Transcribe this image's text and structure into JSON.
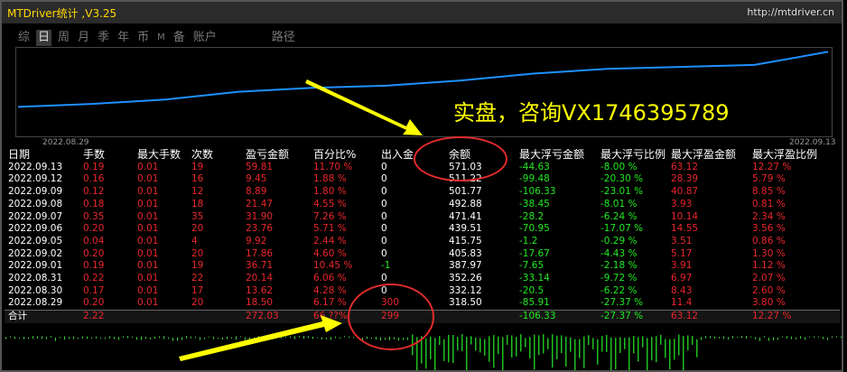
{
  "window": {
    "title": "MTDriver统计 ,V3.25",
    "url": "http://mtdriver.cn"
  },
  "tabs": [
    {
      "label": "综",
      "active": false
    },
    {
      "label": "日",
      "active": true
    },
    {
      "label": "周",
      "active": false
    },
    {
      "label": "月",
      "active": false
    },
    {
      "label": "季",
      "active": false
    },
    {
      "label": "年",
      "active": false
    },
    {
      "label": "币",
      "active": false
    },
    {
      "label": "M",
      "active": false
    },
    {
      "label": "备",
      "active": false
    },
    {
      "label": "账户",
      "active": false
    },
    {
      "label": "路径",
      "active": false
    }
  ],
  "chart_data": {
    "type": "line",
    "x_start": "2022.08.29",
    "x_end": "2022.09.13",
    "x": [
      "2022.08.29",
      "2022.08.30",
      "2022.08.31",
      "2022.09.01",
      "2022.09.02",
      "2022.09.05",
      "2022.09.06",
      "2022.09.07",
      "2022.09.08",
      "2022.09.09",
      "2022.09.12",
      "2022.09.13"
    ],
    "values": [
      318.5,
      332.12,
      352.26,
      387.97,
      405.83,
      415.75,
      439.51,
      471.41,
      492.88,
      501.77,
      511.22,
      571.03
    ],
    "color": "#1e90ff"
  },
  "annotation": {
    "text": "实盘，咨询VX1746395789",
    "color": "#ffff00"
  },
  "table": {
    "headers": [
      "日期",
      "手数",
      "最大手数",
      "次数",
      "盈亏金额",
      "百分比%",
      "出入金",
      "余额",
      "最大浮亏金额",
      "最大浮亏比例",
      "最大浮盈金额",
      "最大浮盈比例"
    ],
    "rows": [
      [
        "2022.09.13",
        "0.19",
        "0.01",
        "19",
        "59.81",
        "11.70 %",
        "0",
        "571.03",
        "-44.63",
        "-8.00 %",
        "63.12",
        "12.27 %"
      ],
      [
        "2022.09.12",
        "0.16",
        "0.01",
        "16",
        "9.45",
        "1.88 %",
        "0",
        "511.22",
        "-99.48",
        "-20.30 %",
        "28.39",
        "5.79 %"
      ],
      [
        "2022.09.09",
        "0.12",
        "0.01",
        "12",
        "8.89",
        "1.80 %",
        "0",
        "501.77",
        "-106.33",
        "-23.01 %",
        "40.87",
        "8.85 %"
      ],
      [
        "2022.09.08",
        "0.18",
        "0.01",
        "18",
        "21.47",
        "4.55 %",
        "0",
        "492.88",
        "-38.45",
        "-8.01 %",
        "3.93",
        "0.81 %"
      ],
      [
        "2022.09.07",
        "0.35",
        "0.01",
        "35",
        "31.90",
        "7.26 %",
        "0",
        "471.41",
        "-28.2",
        "-6.24 %",
        "10.14",
        "2.34 %"
      ],
      [
        "2022.09.06",
        "0.20",
        "0.01",
        "20",
        "23.76",
        "5.71 %",
        "0",
        "439.51",
        "-70.95",
        "-17.07 %",
        "14.55",
        "3.56 %"
      ],
      [
        "2022.09.05",
        "0.04",
        "0.01",
        "4",
        "9.92",
        "2.44 %",
        "0",
        "415.75",
        "-1.2",
        "-0.29 %",
        "3.51",
        "0.86 %"
      ],
      [
        "2022.09.02",
        "0.20",
        "0.01",
        "20",
        "17.86",
        "4.60 %",
        "0",
        "405.83",
        "-17.67",
        "-4.43 %",
        "5.17",
        "1.30 %"
      ],
      [
        "2022.09.01",
        "0.19",
        "0.01",
        "19",
        "36.71",
        "10.45 %",
        "-1",
        "387.97",
        "-7.65",
        "-2.18 %",
        "3.91",
        "1.12 %"
      ],
      [
        "2022.08.31",
        "0.22",
        "0.01",
        "22",
        "20.14",
        "6.06 %",
        "0",
        "352.26",
        "-33.14",
        "-9.72 %",
        "6.97",
        "2.07 %"
      ],
      [
        "2022.08.30",
        "0.17",
        "0.01",
        "17",
        "13.62",
        "4.28 %",
        "0",
        "332.12",
        "-20.5",
        "-6.22 %",
        "8.43",
        "2.60 %"
      ],
      [
        "2022.08.29",
        "0.20",
        "0.01",
        "20",
        "18.50",
        "6.17 %",
        "300",
        "318.50",
        "-85.91",
        "-27.37 %",
        "11.4",
        "3.80 %"
      ]
    ],
    "total": [
      "合计",
      "2.22",
      "",
      "",
      "272.03",
      "66.??%",
      "299",
      "",
      "-106.33",
      "-27.37 %",
      "63.12",
      "12.27 %"
    ]
  },
  "colors": {
    "positive": "#e8262c",
    "negative": "#22e822",
    "neutral": "#ffffff",
    "line": "#1e90ff",
    "marker": "#e32b2b",
    "arrow": "#ffff00"
  }
}
